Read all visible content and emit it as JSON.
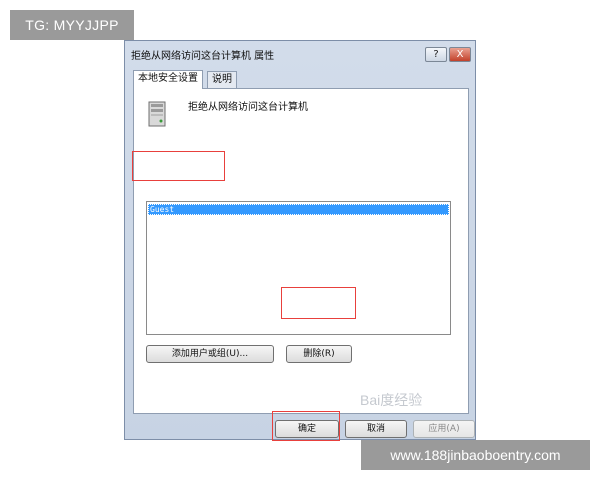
{
  "overlay": {
    "tg_label": "TG: MYYJJPP",
    "url_banner": "www.188jinbaoboentry.com",
    "watermark": "Bai度经验"
  },
  "dialog": {
    "title": "拒绝从网络访问这台计算机 属性",
    "help_button": "?",
    "close_button": "X",
    "tabs": [
      {
        "label": "本地安全设置",
        "active": true
      },
      {
        "label": "说明",
        "active": false
      }
    ],
    "policy_icon": "server-icon",
    "policy_name": "拒绝从网络访问这台计算机",
    "list_items": [
      "Guest"
    ],
    "add_button": "添加用户或组(U)...",
    "remove_button": "删除(R)",
    "ok_button": "确定",
    "cancel_button": "取消",
    "apply_button": "应用(A)"
  },
  "colors": {
    "highlight": "#e8403c",
    "selection": "#3399ff",
    "title_bar": "#c7d3e4",
    "banner_bg": "#9a9a9a"
  }
}
